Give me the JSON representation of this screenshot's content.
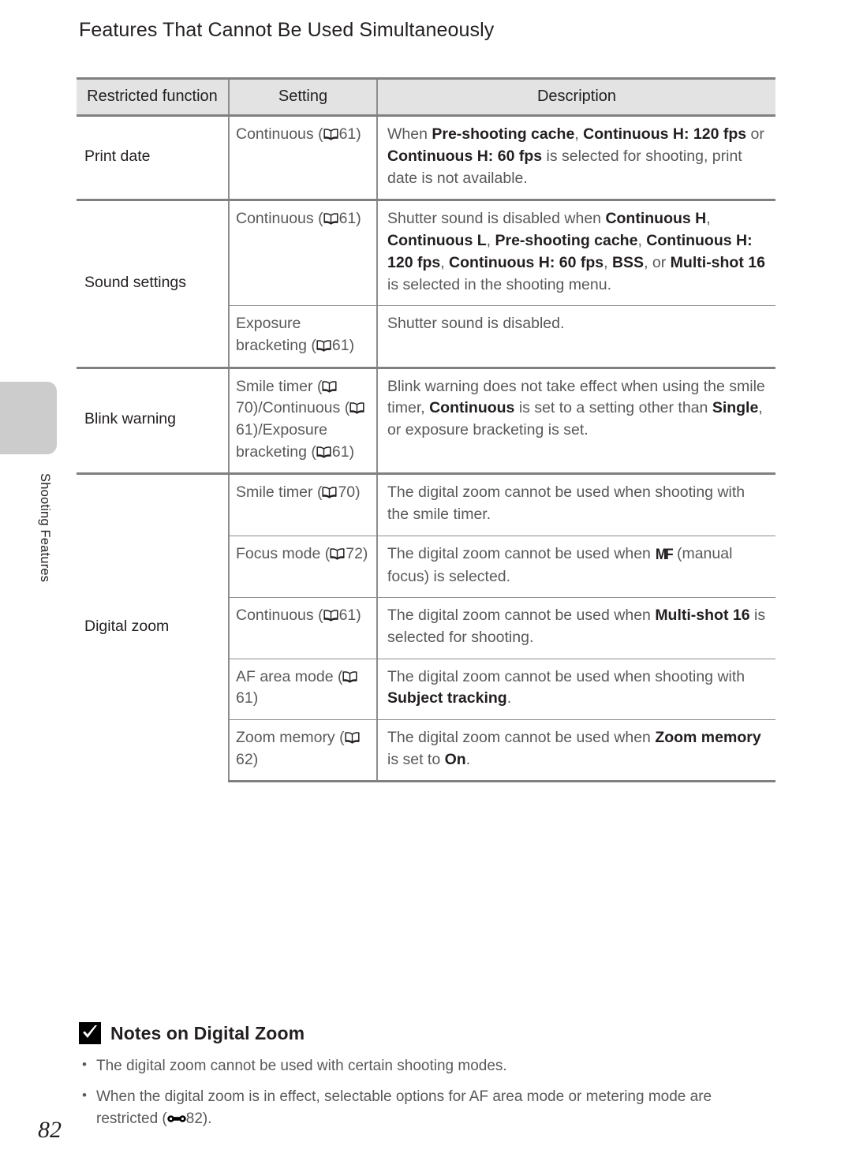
{
  "page": {
    "number": "82",
    "chapter_label": "Shooting Features",
    "section_title": "Features That Cannot Be Used Simultaneously"
  },
  "table": {
    "headers": {
      "restricted_function": "Restricted function",
      "setting": "Setting",
      "description": "Description"
    },
    "rows": [
      {
        "function": "Print date",
        "setting_text": "Continuous",
        "setting_ref": "61",
        "description_runs": [
          {
            "text": "When ",
            "bold": false
          },
          {
            "text": "Pre-shooting cache",
            "bold": true
          },
          {
            "text": ", ",
            "bold": false
          },
          {
            "text": "Continuous H: 120 fps",
            "bold": true
          },
          {
            "text": " or ",
            "bold": false
          },
          {
            "text": "Continuous H: 60 fps",
            "bold": true
          },
          {
            "text": " is selected for shooting, print date is not available.",
            "bold": false
          }
        ]
      },
      {
        "function": "Sound settings",
        "setting_text": "Continuous",
        "setting_ref": "61",
        "description_runs": [
          {
            "text": "Shutter sound is disabled when ",
            "bold": false
          },
          {
            "text": "Continuous H",
            "bold": true
          },
          {
            "text": ", ",
            "bold": false
          },
          {
            "text": "Continuous L",
            "bold": true
          },
          {
            "text": ", ",
            "bold": false
          },
          {
            "text": "Pre-shooting cache",
            "bold": true
          },
          {
            "text": ", ",
            "bold": false
          },
          {
            "text": "Continuous H: 120 fps",
            "bold": true
          },
          {
            "text": ", ",
            "bold": false
          },
          {
            "text": "Continuous H: 60 fps",
            "bold": true
          },
          {
            "text": ", ",
            "bold": false
          },
          {
            "text": "BSS",
            "bold": true
          },
          {
            "text": ", or ",
            "bold": false
          },
          {
            "text": "Multi-shot 16",
            "bold": true
          },
          {
            "text": " is selected in the shooting menu.",
            "bold": false
          }
        ]
      },
      {
        "function": "",
        "setting_text": "Exposure bracketing",
        "setting_ref": "61",
        "description_runs": [
          {
            "text": "Shutter sound is disabled.",
            "bold": false
          }
        ]
      },
      {
        "function": "Blink warning",
        "setting_text": "Smile timer",
        "setting_ref": "70",
        "setting_text2": "Continuous",
        "setting_ref2": "61",
        "setting_text3": "/Exposure bracketing",
        "setting_ref3": "61",
        "description_runs": [
          {
            "text": "Blink warning does not take effect when using the smile timer, ",
            "bold": false
          },
          {
            "text": "Continuous",
            "bold": true
          },
          {
            "text": " is set to a setting other than ",
            "bold": false
          },
          {
            "text": "Single",
            "bold": true
          },
          {
            "text": ", or exposure bracketing is set.",
            "bold": false
          }
        ]
      },
      {
        "function": "Digital zoom",
        "setting_text": "Smile timer",
        "setting_ref": "70",
        "description_runs": [
          {
            "text": "The digital zoom cannot be used when shooting with the smile timer.",
            "bold": false
          }
        ]
      },
      {
        "function": "",
        "setting_text": "Focus mode",
        "setting_ref": "72",
        "description_runs": [
          {
            "text": "The digital zoom cannot be used when ",
            "bold": false
          },
          {
            "text": "MF_GLYPH",
            "bold": false,
            "glyph": "mf-icon"
          },
          {
            "text": " (manual focus) is selected.",
            "bold": false
          }
        ]
      },
      {
        "function": "",
        "setting_text": "Continuous",
        "setting_ref": "61",
        "description_runs": [
          {
            "text": "The digital zoom cannot be used when ",
            "bold": false
          },
          {
            "text": "Multi-shot 16",
            "bold": true
          },
          {
            "text": " is selected for shooting.",
            "bold": false
          }
        ]
      },
      {
        "function": "",
        "setting_text": "AF area mode",
        "setting_ref": "61",
        "description_runs": [
          {
            "text": "The digital zoom cannot be used when shooting with ",
            "bold": false
          },
          {
            "text": "Subject tracking",
            "bold": true
          },
          {
            "text": ".",
            "bold": false
          }
        ]
      },
      {
        "function": "",
        "setting_text": "Zoom memory",
        "setting_ref": "62",
        "description_runs": [
          {
            "text": "The digital zoom cannot be used when ",
            "bold": false
          },
          {
            "text": "Zoom memory",
            "bold": true
          },
          {
            "text": " is set to ",
            "bold": false
          },
          {
            "text": "On",
            "bold": true
          },
          {
            "text": ".",
            "bold": false
          }
        ]
      }
    ]
  },
  "notes": {
    "icon": "check-badge-icon",
    "title": "Notes on Digital Zoom",
    "items": [
      {
        "text_before": "The digital zoom cannot be used with certain shooting modes.",
        "ref": "",
        "text_after": ""
      },
      {
        "text_before": "When the digital zoom is in effect, selectable options for AF area mode or metering mode are restricted (",
        "ref": "82",
        "text_after": ")."
      }
    ]
  },
  "colors": {
    "header_fill": "#e3e3e3",
    "rule": "#808080",
    "body_text": "#58595b",
    "emphasis_text": "#231f20",
    "tab_gray": "#cccccc"
  }
}
